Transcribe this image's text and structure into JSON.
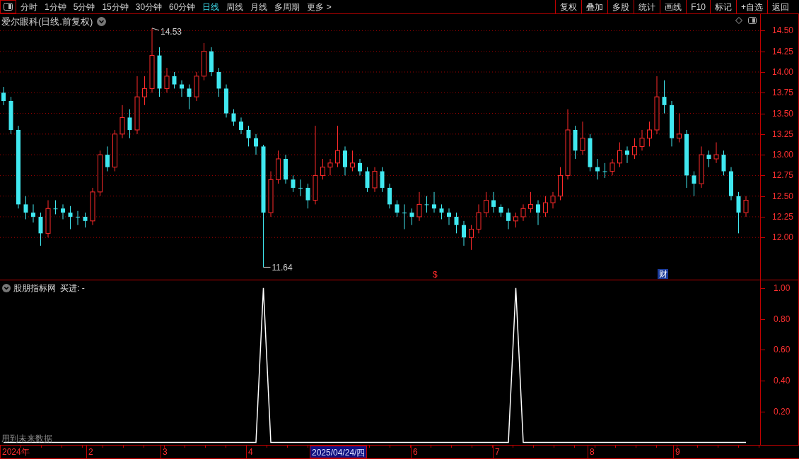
{
  "toolbar": {
    "periods": [
      {
        "label": "分时",
        "selected": false
      },
      {
        "label": "1分钟",
        "selected": false
      },
      {
        "label": "5分钟",
        "selected": false
      },
      {
        "label": "15分钟",
        "selected": false
      },
      {
        "label": "30分钟",
        "selected": false
      },
      {
        "label": "60分钟",
        "selected": false
      },
      {
        "label": "日线",
        "selected": true
      },
      {
        "label": "周线",
        "selected": false
      },
      {
        "label": "月线",
        "selected": false
      },
      {
        "label": "多周期",
        "selected": false
      },
      {
        "label": "更多 >",
        "selected": false
      }
    ],
    "buttons": [
      "复权",
      "叠加",
      "多股",
      "统计",
      "画线",
      "F10",
      "标记",
      "+自选",
      "返回"
    ]
  },
  "main_chart": {
    "title": "爱尔眼科(日线.前复权)",
    "high_label": "14.53",
    "low_label": "11.64",
    "chart_data": {
      "type": "candlestick",
      "grid": true,
      "ylim": [
        11.49,
        14.7
      ],
      "yticks": [
        {
          "value": 14.5,
          "label": "14.50"
        },
        {
          "value": 14.25,
          "label": "14.25"
        },
        {
          "value": 14.0,
          "label": "14.00"
        },
        {
          "value": 13.75,
          "label": "13.75"
        },
        {
          "value": 13.5,
          "label": "13.50"
        },
        {
          "value": 13.25,
          "label": "13.25"
        },
        {
          "value": 13.0,
          "label": "13.00"
        },
        {
          "value": 12.75,
          "label": "12.75"
        },
        {
          "value": 12.5,
          "label": "12.50"
        },
        {
          "value": 12.25,
          "label": "12.25"
        },
        {
          "value": 12.0,
          "label": "12.00"
        }
      ],
      "ohlc": [
        [
          13.75,
          13.82,
          13.6,
          13.65
        ],
        [
          13.65,
          13.7,
          13.25,
          13.3
        ],
        [
          13.3,
          13.35,
          12.35,
          12.4
        ],
        [
          12.4,
          12.5,
          12.22,
          12.3
        ],
        [
          12.3,
          12.4,
          12.18,
          12.25
        ],
        [
          12.25,
          12.3,
          11.9,
          12.05
        ],
        [
          12.05,
          12.45,
          12.0,
          12.35
        ],
        [
          12.35,
          12.45,
          12.28,
          12.35
        ],
        [
          12.35,
          12.4,
          12.22,
          12.3
        ],
        [
          12.3,
          12.38,
          12.1,
          12.25
        ],
        [
          12.25,
          12.32,
          12.15,
          12.25
        ],
        [
          12.25,
          12.3,
          12.12,
          12.2
        ],
        [
          12.2,
          12.6,
          12.15,
          12.55
        ],
        [
          12.55,
          13.05,
          12.5,
          13.0
        ],
        [
          13.0,
          13.1,
          12.8,
          12.85
        ],
        [
          12.85,
          13.3,
          12.8,
          13.25
        ],
        [
          13.25,
          13.6,
          13.2,
          13.45
        ],
        [
          13.45,
          13.55,
          13.2,
          13.3
        ],
        [
          13.3,
          13.95,
          13.25,
          13.7
        ],
        [
          13.7,
          13.95,
          13.6,
          13.8
        ],
        [
          13.8,
          14.53,
          13.75,
          14.2
        ],
        [
          14.2,
          14.3,
          13.7,
          13.8
        ],
        [
          13.8,
          14.05,
          13.75,
          13.95
        ],
        [
          13.95,
          14.0,
          13.8,
          13.85
        ],
        [
          13.85,
          13.9,
          13.7,
          13.8
        ],
        [
          13.8,
          13.85,
          13.55,
          13.7
        ],
        [
          13.7,
          14.0,
          13.65,
          13.95
        ],
        [
          13.95,
          14.35,
          13.9,
          14.25
        ],
        [
          14.25,
          14.3,
          13.95,
          14.0
        ],
        [
          14.0,
          14.05,
          13.7,
          13.8
        ],
        [
          13.8,
          13.85,
          13.45,
          13.5
        ],
        [
          13.5,
          13.55,
          13.35,
          13.4
        ],
        [
          13.4,
          13.45,
          13.25,
          13.3
        ],
        [
          13.3,
          13.35,
          13.1,
          13.2
        ],
        [
          13.2,
          13.25,
          13.0,
          13.1
        ],
        [
          13.1,
          13.12,
          11.64,
          12.3
        ],
        [
          12.3,
          12.8,
          12.25,
          12.7
        ],
        [
          12.7,
          13.05,
          12.65,
          12.95
        ],
        [
          12.95,
          13.0,
          12.65,
          12.7
        ],
        [
          12.7,
          12.75,
          12.55,
          12.6
        ],
        [
          12.6,
          12.7,
          12.5,
          12.6
        ],
        [
          12.6,
          12.65,
          12.35,
          12.45
        ],
        [
          12.45,
          13.35,
          12.4,
          12.75
        ],
        [
          12.75,
          12.95,
          12.7,
          12.85
        ],
        [
          12.85,
          12.95,
          12.75,
          12.9
        ],
        [
          12.9,
          13.35,
          12.85,
          13.05
        ],
        [
          13.05,
          13.1,
          12.75,
          12.85
        ],
        [
          12.85,
          13.05,
          12.8,
          12.9
        ],
        [
          12.9,
          12.95,
          12.75,
          12.8
        ],
        [
          12.8,
          12.85,
          12.55,
          12.6
        ],
        [
          12.6,
          12.85,
          12.55,
          12.8
        ],
        [
          12.8,
          12.85,
          12.55,
          12.6
        ],
        [
          12.6,
          12.65,
          12.35,
          12.4
        ],
        [
          12.4,
          12.45,
          12.25,
          12.3
        ],
        [
          12.3,
          12.4,
          12.1,
          12.3
        ],
        [
          12.3,
          12.35,
          12.15,
          12.25
        ],
        [
          12.25,
          12.55,
          12.2,
          12.4
        ],
        [
          12.4,
          12.5,
          12.3,
          12.4
        ],
        [
          12.4,
          12.55,
          12.3,
          12.35
        ],
        [
          12.35,
          12.4,
          12.22,
          12.3
        ],
        [
          12.3,
          12.35,
          12.15,
          12.25
        ],
        [
          12.25,
          12.3,
          12.05,
          12.15
        ],
        [
          12.15,
          12.2,
          11.9,
          12.0
        ],
        [
          12.0,
          12.15,
          11.85,
          12.1
        ],
        [
          12.1,
          12.4,
          12.05,
          12.3
        ],
        [
          12.3,
          12.55,
          12.25,
          12.45
        ],
        [
          12.45,
          12.55,
          12.3,
          12.37
        ],
        [
          12.37,
          12.4,
          12.25,
          12.3
        ],
        [
          12.3,
          12.35,
          12.1,
          12.2
        ],
        [
          12.2,
          12.3,
          12.12,
          12.25
        ],
        [
          12.25,
          12.4,
          12.2,
          12.35
        ],
        [
          12.35,
          12.55,
          12.3,
          12.4
        ],
        [
          12.4,
          12.45,
          12.15,
          12.3
        ],
        [
          12.3,
          12.5,
          12.25,
          12.42
        ],
        [
          12.42,
          12.55,
          12.35,
          12.5
        ],
        [
          12.5,
          12.85,
          12.45,
          12.75
        ],
        [
          12.75,
          13.55,
          12.7,
          13.3
        ],
        [
          13.3,
          13.35,
          12.95,
          13.05
        ],
        [
          13.05,
          13.4,
          13.0,
          13.2
        ],
        [
          13.2,
          13.25,
          12.8,
          12.85
        ],
        [
          12.85,
          12.95,
          12.7,
          12.8
        ],
        [
          12.8,
          12.9,
          12.72,
          12.8
        ],
        [
          12.8,
          12.95,
          12.75,
          12.9
        ],
        [
          12.9,
          13.15,
          12.85,
          13.05
        ],
        [
          13.05,
          13.1,
          12.9,
          13.0
        ],
        [
          13.0,
          13.2,
          12.95,
          13.1
        ],
        [
          13.1,
          13.3,
          13.05,
          13.2
        ],
        [
          13.2,
          13.4,
          13.1,
          13.3
        ],
        [
          13.3,
          13.95,
          13.25,
          13.7
        ],
        [
          13.7,
          13.9,
          13.5,
          13.6
        ],
        [
          13.6,
          13.65,
          13.1,
          13.2
        ],
        [
          13.2,
          13.5,
          13.15,
          13.25
        ],
        [
          13.25,
          13.3,
          12.6,
          12.75
        ],
        [
          12.75,
          12.8,
          12.5,
          12.65
        ],
        [
          12.65,
          13.1,
          12.6,
          13.0
        ],
        [
          13.0,
          13.05,
          12.85,
          12.95
        ],
        [
          12.95,
          13.15,
          12.9,
          13.0
        ],
        [
          13.0,
          13.05,
          12.75,
          12.8
        ],
        [
          12.8,
          12.85,
          12.45,
          12.5
        ],
        [
          12.5,
          12.55,
          12.05,
          12.3
        ],
        [
          12.3,
          12.5,
          12.25,
          12.45
        ]
      ]
    },
    "events": [
      {
        "kind": "dollar",
        "label": "$"
      },
      {
        "kind": "finance",
        "label": "财"
      }
    ]
  },
  "indicator": {
    "title": "股朋指标网",
    "reading": ": -",
    "note": "用到未来数据",
    "chart_data": {
      "type": "line",
      "ylim": [
        -0.02,
        1.05
      ],
      "yticks": [
        {
          "value": 0.2,
          "label": "0.20"
        },
        {
          "value": 0.4,
          "label": "0.40"
        },
        {
          "value": 0.6,
          "label": "0.60"
        },
        {
          "value": 0.8,
          "label": "0.80"
        },
        {
          "value": 1.0,
          "label": "1.00"
        }
      ],
      "series": [
        {
          "name": "买进",
          "color": "#ffffff",
          "values": [
            0,
            0,
            0,
            0,
            0,
            0,
            0,
            0,
            0,
            0,
            0,
            0,
            0,
            0,
            0,
            0,
            0,
            0,
            0,
            0,
            0,
            0,
            0,
            0,
            0,
            0,
            0,
            0,
            0,
            0,
            0,
            0,
            0,
            0,
            0,
            1,
            0,
            0,
            0,
            0,
            0,
            0,
            0,
            0,
            0,
            0,
            0,
            0,
            0,
            0,
            0,
            0,
            0,
            0,
            0,
            0,
            0,
            0,
            0,
            0,
            0,
            0,
            0,
            0,
            0,
            0,
            0,
            0,
            0,
            1,
            0,
            0,
            0,
            0,
            0,
            0,
            0,
            0,
            0,
            0,
            0,
            0,
            0,
            0,
            0,
            0,
            0,
            0,
            0,
            0,
            0,
            0,
            0,
            0,
            0,
            0,
            0,
            0,
            0,
            0,
            0
          ]
        }
      ]
    }
  },
  "date_axis": {
    "labels": [
      {
        "label": "2024年",
        "selected": false
      },
      {
        "label": "2",
        "selected": false
      },
      {
        "label": "3",
        "selected": false
      },
      {
        "label": "4",
        "selected": false
      },
      {
        "label": "2025/04/24/四",
        "selected": true
      },
      {
        "label": "6",
        "selected": false
      },
      {
        "label": "7",
        "selected": false
      },
      {
        "label": "8",
        "selected": false
      },
      {
        "label": "9",
        "selected": false
      }
    ]
  }
}
